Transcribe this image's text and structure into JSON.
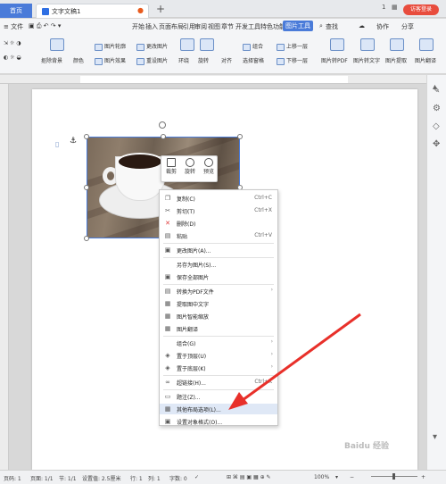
{
  "titlebar": {
    "home_tab": "首页",
    "doc_tab": "文字文稿1",
    "new_tab": "+",
    "window_num": "1",
    "login": "访客登录"
  },
  "menubar": {
    "file": "≡ 文件",
    "items": [
      "开始",
      "插入",
      "页面布局",
      "引用",
      "审阅",
      "视图",
      "章节",
      "开发工具",
      "特色功能"
    ],
    "active": "图片工具",
    "search": "查找",
    "right": [
      "协作",
      "分享"
    ]
  },
  "ribbon": {
    "labels": [
      "抠除背景",
      "颜色",
      "图片轮廓",
      "图片效果",
      "更改图片",
      "重设图片",
      "环绕",
      "旋转",
      "对齐",
      "组合",
      "选择窗格",
      "上移一层",
      "下移一层"
    ],
    "big_buttons": [
      "图片转PDF",
      "图片转文字",
      "图片提取",
      "图片翻译"
    ]
  },
  "float_toolbar": [
    "裁剪",
    "旋转",
    "预览"
  ],
  "context_menu": [
    {
      "label": "复制(C)",
      "key": "Ctrl+C",
      "icon": "copy-icon"
    },
    {
      "label": "剪切(T)",
      "key": "Ctrl+X",
      "icon": "cut-icon"
    },
    {
      "label": "删除(D)",
      "key": "",
      "icon": "delete-icon"
    },
    {
      "label": "粘贴",
      "key": "Ctrl+V",
      "icon": "paste-icon"
    },
    {
      "label": "更改图片(A)...",
      "key": "",
      "icon": "change-image-icon"
    },
    {
      "label": "另存为图片(S)...",
      "key": "",
      "icon": ""
    },
    {
      "label": "保存全部图片",
      "key": "",
      "icon": "save-all-icon"
    },
    {
      "label": "转换为PDF文件",
      "key": "",
      "icon": "pdf-icon"
    },
    {
      "label": "提取图中文字",
      "key": "",
      "icon": "ocr-icon"
    },
    {
      "label": "图片智能缩放",
      "key": "",
      "icon": "smart-zoom-icon"
    },
    {
      "label": "图片翻译",
      "key": "",
      "icon": "translate-icon"
    },
    {
      "label": "组合(G)",
      "key": "",
      "icon": ""
    },
    {
      "label": "置于顶层(U)",
      "key": "",
      "icon": "bring-front-icon"
    },
    {
      "label": "置于底层(K)",
      "key": "",
      "icon": "send-back-icon"
    },
    {
      "label": "超链接(H)...",
      "key": "Ctrl+K",
      "icon": "hyperlink-icon"
    },
    {
      "label": "题注(Z)...",
      "key": "",
      "icon": "caption-icon"
    },
    {
      "label": "其他布局选项(L)...",
      "key": "",
      "icon": "layout-options-icon"
    },
    {
      "label": "设置对象格式(O)...",
      "key": "",
      "icon": "format-object-icon"
    }
  ],
  "statusbar": {
    "page_num": "页码: 1",
    "pages": "页面: 1/1",
    "section": "节: 1/1",
    "setting": "设置值: 2.5厘米",
    "row": "行: 1",
    "col": "列: 1",
    "words": "字数: 0",
    "zoom": "100%"
  },
  "watermark": "Baidu 经验",
  "colors": {
    "accent": "#4a7bd9",
    "arrow": "#e8302a",
    "login": "#e84c3d"
  }
}
